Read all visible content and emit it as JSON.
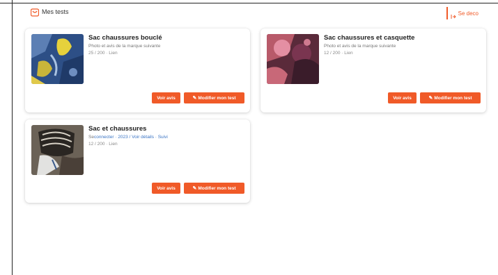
{
  "header": {
    "brand_label": "Mes tests",
    "logout_label": "Se deco"
  },
  "cards": [
    {
      "title": "Sac chaussures bouclé",
      "subtitle": "Photo et avis de la marque suivante",
      "meta": "25 / 200 · Lien",
      "btn_primary": "Voir avis",
      "btn_secondary": "Modifier mon test"
    },
    {
      "title": "Sac chaussures et casquette",
      "subtitle": "Photo et avis de la marque suivante",
      "meta": "12 / 200 · Lien",
      "btn_primary": "Voir avis",
      "btn_secondary": "Modifier mon test"
    },
    {
      "title": "Sac et chaussures",
      "subtitle_pre": "Se",
      "subtitle_link": "connecter · 2023 / Voir détails · Suivi",
      "meta": "12 / 200 · Lien",
      "btn_primary": "Voir avis",
      "btn_secondary": "Modifier mon test"
    }
  ],
  "colors": {
    "accent": "#f05a28",
    "link": "#3a74c4"
  }
}
